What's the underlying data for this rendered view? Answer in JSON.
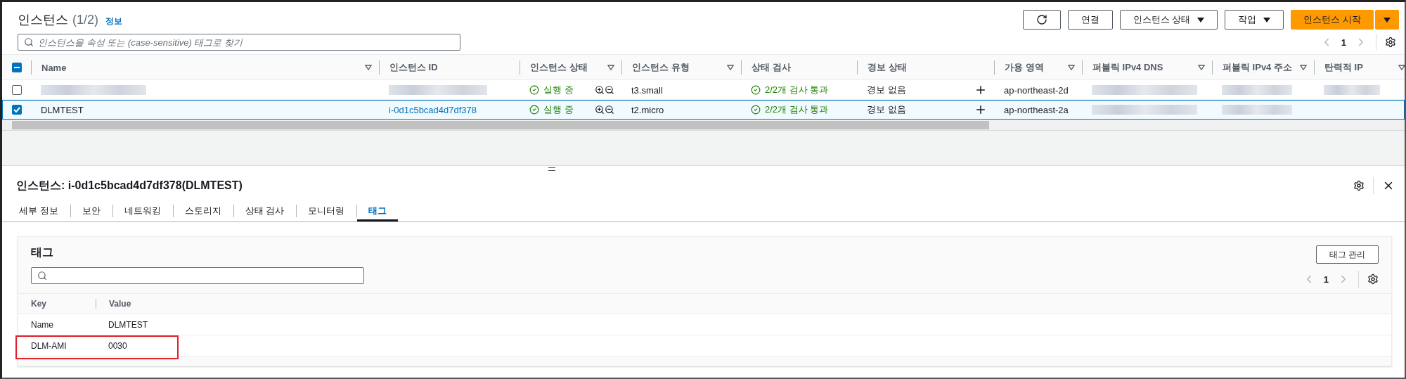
{
  "instances": {
    "title": "인스턴스",
    "count": "(1/2)",
    "info_link": "정보",
    "buttons": [
      {
        "kind": "refresh"
      },
      {
        "kind": "plain",
        "label": "연결"
      },
      {
        "kind": "dropdown",
        "label": "인스턴스 상태"
      },
      {
        "kind": "dropdown",
        "label": "작업"
      },
      {
        "kind": "primary",
        "label": "인스턴스 시작"
      }
    ],
    "search": {
      "placeholder": "인스턴스을 속성 또는 (case-sensitive) 태그로 찾기"
    },
    "page": "1",
    "select_all_indeterminate": true,
    "columns": [
      {
        "label": "Name",
        "filter": true
      },
      {
        "label": "인스턴스 ID",
        "filter": false
      },
      {
        "label": "인스턴스 상태",
        "filter": true
      },
      {
        "label": "인스턴스 유형",
        "filter": true
      },
      {
        "label": "상태 검사",
        "filter": false
      },
      {
        "label": "경보 상태",
        "filter": false
      },
      {
        "label": "가용 영역",
        "filter": true
      },
      {
        "label": "퍼블릭 IPv4 DNS",
        "filter": true
      },
      {
        "label": "퍼블릭 IPv4 주소",
        "filter": true
      },
      {
        "label": "탄력적 IP",
        "filter": true
      }
    ],
    "rows": [
      {
        "selected": false,
        "checked": false,
        "cells": [
          {
            "kind": "redacted"
          },
          {
            "kind": "redacted"
          },
          {
            "kind": "state",
            "text": "실행 중"
          },
          {
            "kind": "text",
            "text": "t3.small"
          },
          {
            "kind": "check",
            "text": "2/2개 검사 통과"
          },
          {
            "kind": "alarm",
            "text": "경보 없음"
          },
          {
            "kind": "text",
            "text": "ap-northeast-2d"
          },
          {
            "kind": "redacted"
          },
          {
            "kind": "redacted"
          },
          {
            "kind": "redacted"
          }
        ]
      },
      {
        "selected": true,
        "checked": true,
        "cells": [
          {
            "kind": "text",
            "text": "DLMTEST"
          },
          {
            "kind": "link",
            "text": "i-0d1c5bcad4d7df378"
          },
          {
            "kind": "state",
            "text": "실행 중"
          },
          {
            "kind": "text",
            "text": "t2.micro"
          },
          {
            "kind": "check",
            "text": "2/2개 검사 통과"
          },
          {
            "kind": "alarm",
            "text": "경보 없음"
          },
          {
            "kind": "text",
            "text": "ap-northeast-2a"
          },
          {
            "kind": "redacted"
          },
          {
            "kind": "redacted"
          },
          {
            "kind": "blank"
          }
        ]
      }
    ]
  },
  "detail": {
    "title": "인스턴스: i-0d1c5bcad4d7df378(DLMTEST)",
    "tabs": [
      {
        "label": "세부 정보",
        "selected": false
      },
      {
        "label": "보안",
        "selected": false
      },
      {
        "label": "네트워킹",
        "selected": false
      },
      {
        "label": "스토리지",
        "selected": false
      },
      {
        "label": "상태 검사",
        "selected": false
      },
      {
        "label": "모니터링",
        "selected": false
      },
      {
        "label": "태그",
        "selected": true
      }
    ],
    "tags": {
      "title": "태그",
      "manage_button": "태그 관리",
      "page": "1",
      "columns": [
        "Key",
        "Value"
      ],
      "rows": [
        {
          "key": "Name",
          "value": "DLMTEST",
          "highlighted": false
        },
        {
          "key": "DLM-AMI",
          "value": "0030",
          "highlighted": true
        }
      ]
    }
  }
}
